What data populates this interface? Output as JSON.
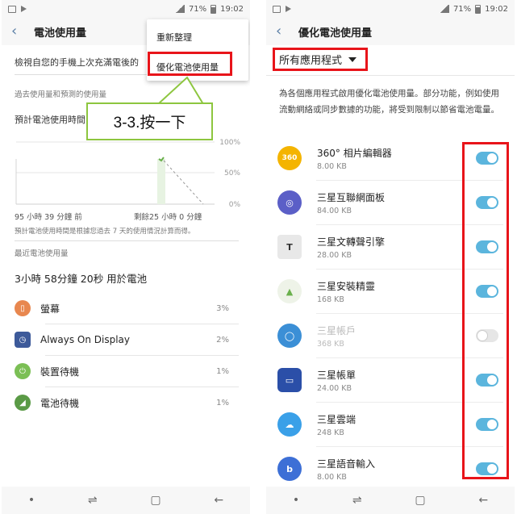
{
  "status_bar": {
    "battery": "71%",
    "time": "19:02"
  },
  "left": {
    "title": "電池使用量",
    "menu": {
      "refresh": "重新整理",
      "optimize": "優化電池使用量"
    },
    "callout": "3-3.按一下",
    "intro": "檢視自您的手機上次充滿電後的",
    "section_past": "過去使用量和預測的使用量",
    "predicted": "預計電池使用時間",
    "axis_pct": [
      "100%",
      "50%",
      "0%"
    ],
    "chart_left_label": "95 小時 39 分鐘 前",
    "chart_right_label": "剩餘25 小時 0 分鐘",
    "chart_note": "預計電池使用時間是根據您過去 7 天的使用情況計算而得。",
    "section_recent": "最近電池使用量",
    "usage_total": "3小時 58分鐘 20秒 用於電池",
    "usage_items": [
      {
        "label": "螢幕",
        "pct": "3%",
        "color": "#e8874f",
        "icon": "screen-icon"
      },
      {
        "label": "Always On Display",
        "pct": "2%",
        "color": "#3d5a9a",
        "icon": "clock-icon"
      },
      {
        "label": "裝置待機",
        "pct": "1%",
        "color": "#7bbf55",
        "icon": "power-icon"
      },
      {
        "label": "電池待機",
        "pct": "1%",
        "color": "#5a9a46",
        "icon": "signal-icon"
      }
    ]
  },
  "right": {
    "title": "優化電池使用量",
    "filter": "所有應用程式",
    "description": "為各個應用程式啟用優化電池使用量。部分功能，例如使用流動網絡或同步數據的功能，將受到限制以節省電池電量。",
    "apps": [
      {
        "name": "360° 相片編輯器",
        "size": "8.00 KB",
        "enabled": true,
        "color": "#f4b400",
        "glyph": "360"
      },
      {
        "name": "三星互聯網面板",
        "size": "84.00 KB",
        "enabled": true,
        "color": "#5b5fc7",
        "glyph": "◎"
      },
      {
        "name": "三星文轉聲引擎",
        "size": "28.00 KB",
        "enabled": true,
        "color": "#e8e8e8",
        "glyph": "T"
      },
      {
        "name": "三星安裝精靈",
        "size": "168 KB",
        "enabled": true,
        "color": "#eef3e8",
        "glyph": "▲"
      },
      {
        "name": "三星帳戶",
        "size": "368 KB",
        "enabled": false,
        "color": "#3b8fd6",
        "glyph": "◯"
      },
      {
        "name": "三星帳單",
        "size": "24.00 KB",
        "enabled": true,
        "color": "#2b4fa8",
        "glyph": "▭"
      },
      {
        "name": "三星雲端",
        "size": "248 KB",
        "enabled": true,
        "color": "#3aa0e8",
        "glyph": "☁"
      },
      {
        "name": "三星語音輸入",
        "size": "8.00 KB",
        "enabled": true,
        "color": "#3d6fd6",
        "glyph": "b"
      }
    ]
  }
}
